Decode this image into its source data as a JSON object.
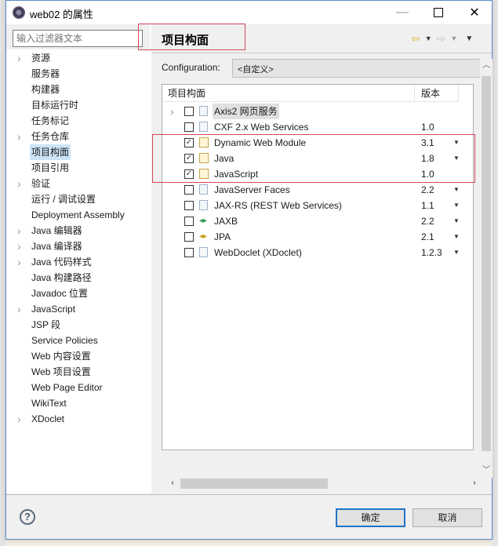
{
  "window": {
    "title": "web02 的属性",
    "minimize_label": "—",
    "maximize_label": "",
    "close_label": "✕"
  },
  "filter": {
    "placeholder": "输入过滤器文本",
    "value": ""
  },
  "nav": {
    "items": [
      {
        "label": "资源",
        "expandable": true
      },
      {
        "label": "服务器",
        "expandable": false
      },
      {
        "label": "构建器",
        "expandable": false
      },
      {
        "label": "目标运行时",
        "expandable": false
      },
      {
        "label": "任务标记",
        "expandable": false
      },
      {
        "label": "任务仓库",
        "expandable": true
      },
      {
        "label": "项目构面",
        "expandable": false,
        "selected": true
      },
      {
        "label": "项目引用",
        "expandable": false
      },
      {
        "label": "验证",
        "expandable": true
      },
      {
        "label": "运行 / 调试设置",
        "expandable": false
      },
      {
        "label": "Deployment Assembly",
        "expandable": false
      },
      {
        "label": "Java 编辑器",
        "expandable": true
      },
      {
        "label": "Java 编译器",
        "expandable": true
      },
      {
        "label": "Java 代码样式",
        "expandable": true
      },
      {
        "label": "Java 构建路径",
        "expandable": false
      },
      {
        "label": "Javadoc 位置",
        "expandable": false
      },
      {
        "label": "JavaScript",
        "expandable": true
      },
      {
        "label": "JSP 段",
        "expandable": false
      },
      {
        "label": "Service Policies",
        "expandable": false
      },
      {
        "label": "Web 内容设置",
        "expandable": false
      },
      {
        "label": "Web 项目设置",
        "expandable": false
      },
      {
        "label": "Web Page Editor",
        "expandable": false
      },
      {
        "label": "WikiText",
        "expandable": false
      },
      {
        "label": "XDoclet",
        "expandable": true
      }
    ]
  },
  "page": {
    "title": "项目构面",
    "back_icon": "⇦",
    "forward_icon": "⇨",
    "dropdown_icon": "▼"
  },
  "configuration": {
    "label": "Configuration:",
    "value": "<自定义>"
  },
  "facets": {
    "columns": [
      "项目构面",
      "版本"
    ],
    "rows": [
      {
        "name": "Axis2 网页服务",
        "version": "",
        "checked": false,
        "expandable": true,
        "has_dropdown": false,
        "icon": "doc",
        "highlighted": true
      },
      {
        "name": "CXF 2.x Web Services",
        "version": "1.0",
        "checked": false,
        "has_dropdown": false,
        "icon": "doc"
      },
      {
        "name": "Dynamic Web Module",
        "version": "3.1",
        "checked": true,
        "has_dropdown": true,
        "icon": "locked-web"
      },
      {
        "name": "Java",
        "version": "1.8",
        "checked": true,
        "has_dropdown": true,
        "icon": "locked-java"
      },
      {
        "name": "JavaScript",
        "version": "1.0",
        "checked": true,
        "has_dropdown": false,
        "icon": "locked-doc"
      },
      {
        "name": "JavaServer Faces",
        "version": "2.2",
        "checked": false,
        "has_dropdown": true,
        "icon": "doc"
      },
      {
        "name": "JAX-RS (REST Web Services)",
        "version": "1.1",
        "checked": false,
        "has_dropdown": true,
        "icon": "doc"
      },
      {
        "name": "JAXB",
        "version": "2.2",
        "checked": false,
        "has_dropdown": true,
        "icon": "arrows-green"
      },
      {
        "name": "JPA",
        "version": "2.1",
        "checked": false,
        "has_dropdown": true,
        "icon": "arrows-gold"
      },
      {
        "name": "WebDoclet (XDoclet)",
        "version": "1.2.3",
        "checked": false,
        "has_dropdown": true,
        "icon": "doc"
      }
    ]
  },
  "buttons": {
    "ok": "确定",
    "cancel": "取消",
    "help": "?"
  },
  "colors": {
    "highlight_box": "#d4475a",
    "selection": "#cce4f7",
    "ok_border": "#1f73c8"
  }
}
